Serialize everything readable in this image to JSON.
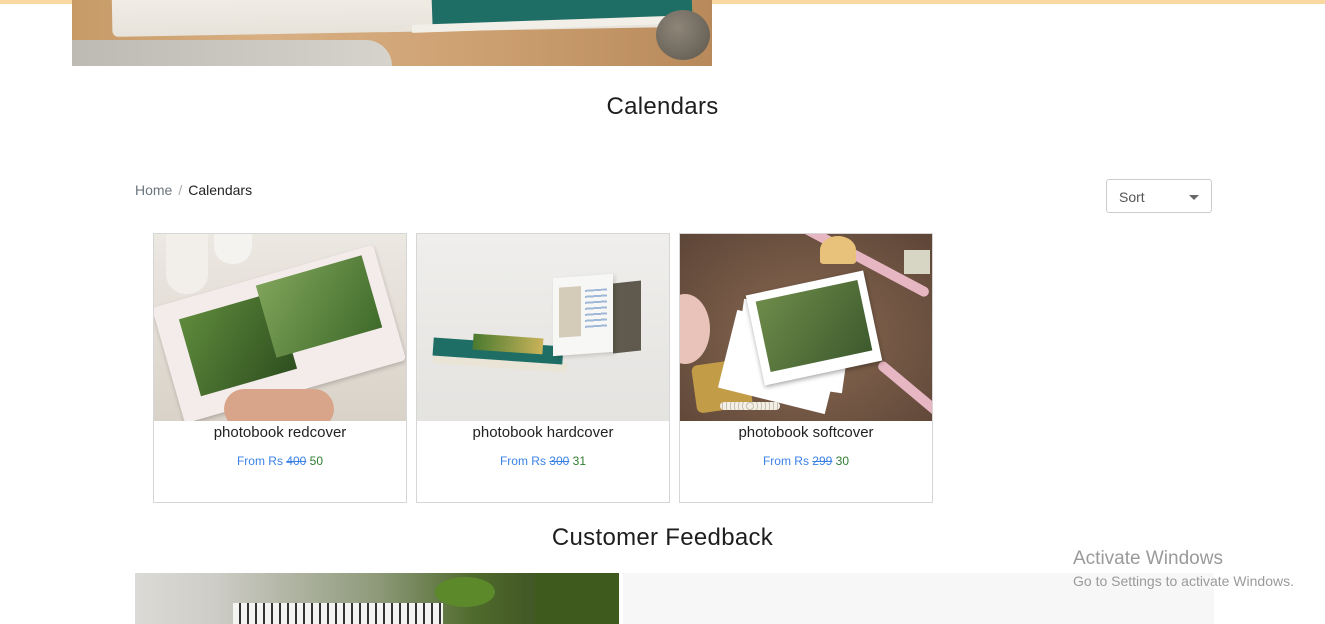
{
  "page": {
    "title": "Calendars"
  },
  "breadcrumb": {
    "home": "Home",
    "separator": "/",
    "current": "Calendars"
  },
  "sort": {
    "label": "Sort",
    "icon": "caret-down-icon"
  },
  "products": [
    {
      "name": "photobook redcover",
      "from": "From Rs",
      "old_price": "400",
      "price": "50"
    },
    {
      "name": "photobook hardcover",
      "from": "From Rs",
      "old_price": "300",
      "price": "31"
    },
    {
      "name": "photobook softcover",
      "from": "From Rs",
      "old_price": "299",
      "price": "30"
    }
  ],
  "feedback": {
    "title": "Customer Feedback"
  },
  "watermark": {
    "line1": "Activate Windows",
    "line2": "Go to Settings to activate Windows."
  },
  "colors": {
    "top_stripe": "#f9d9a0",
    "price_link": "#3b82e6",
    "price_new": "#2f7d32",
    "teal": "#1f6e66"
  }
}
